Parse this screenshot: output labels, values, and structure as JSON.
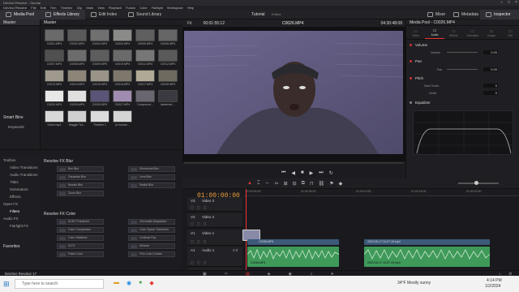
{
  "window": {
    "title": "DaVinci Resolve - Tutorial"
  },
  "menu": [
    "DaVinci Resolve",
    "File",
    "Edit",
    "Trim",
    "Timeline",
    "Clip",
    "Mark",
    "View",
    "Playback",
    "Fusion",
    "Color",
    "Fairlight",
    "Workspace",
    "Help"
  ],
  "toolbar": {
    "media_pool": "Media Pool",
    "effects_library": "Effects Library",
    "edit_index": "Edit Index",
    "sound_library": "Sound Library",
    "project_name": "Tutorial",
    "project_state": "Edited",
    "mixer": "Mixer",
    "metadata": "Metadata",
    "inspector": "Inspector"
  },
  "bins": {
    "master": "Master",
    "smart_bins": "Smart Bins",
    "keywords": "Keywords",
    "favorites": "Favorites"
  },
  "pool": {
    "header": "Master",
    "clips": [
      {
        "label": "C0001.MP4",
        "color": "#6a6a6a"
      },
      {
        "label": "C0002.MP4",
        "color": "#5a5a5a"
      },
      {
        "label": "C0003.MP4",
        "color": "#707070"
      },
      {
        "label": "C0004.MP4",
        "color": "#8a8a88"
      },
      {
        "label": "C0005.MP4",
        "color": "#5f5f5f"
      },
      {
        "label": "C0006.MP4",
        "color": "#666666"
      },
      {
        "label": "C0007.MP4",
        "color": "#505050"
      },
      {
        "label": "C0008.MP4",
        "color": "#6c6c6c"
      },
      {
        "label": "C0009.MP4",
        "color": "#5d5d5d"
      },
      {
        "label": "C0010.MP4",
        "color": "#6a6a6a"
      },
      {
        "label": "C0011.MP4",
        "color": "#777777"
      },
      {
        "label": "C0012.MP4",
        "color": "#5a5a5a"
      },
      {
        "label": "C0013.MP4",
        "color": "#a09a8e"
      },
      {
        "label": "C0014.MP4",
        "color": "#8c8578"
      },
      {
        "label": "C0015.MP4",
        "color": "#9a9488"
      },
      {
        "label": "C0016.MP4",
        "color": "#7d776c"
      },
      {
        "label": "C0017.MP4",
        "color": "#b0a996"
      },
      {
        "label": "C0018.MP4",
        "color": "#6f6a60"
      },
      {
        "label": "C0020.MP4",
        "color": "#e8e8e8"
      },
      {
        "label": "C0025.MP4",
        "color": "#e0e0e0"
      },
      {
        "label": "C0026.MP4",
        "color": "#5a5478"
      },
      {
        "label": "C0027.MP4",
        "color": "#a08cb0"
      },
      {
        "label": "Compound...",
        "color": "#6a6670"
      },
      {
        "label": "darkened ...",
        "color": "#3a3a40"
      },
      {
        "label": "Dutch.mp4",
        "color": "#d8d8d8"
      },
      {
        "label": "Maggie Tra...",
        "color": "#d0d0d0"
      },
      {
        "label": "Timeline 1",
        "color": "#dcdcdc"
      },
      {
        "label": "ja human...",
        "color": "#d4d4d4"
      }
    ]
  },
  "viewer": {
    "fit": "Fit",
    "source_tc": "00:01:55:12",
    "clip_name": "C0026.MP4",
    "duration_tc": "04:30:48:08"
  },
  "inspector": {
    "header": "Media Pool - C0026.MP4",
    "tabs": [
      "Video",
      "Audio",
      "Effects",
      "Transition",
      "Image",
      "File"
    ],
    "active_tab": "Audio",
    "volume": {
      "label": "Volume",
      "param": "Volume",
      "value": "0.00"
    },
    "pan": {
      "label": "Pan",
      "param": "Pan",
      "value": "0.00"
    },
    "pitch": {
      "label": "Pitch",
      "semitones_label": "Semi Tones",
      "semitones_value": "0",
      "cents_label": "Cents",
      "cents_value": "0"
    },
    "equalizer": {
      "label": "Equalizer"
    }
  },
  "effects": {
    "tree": [
      {
        "label": "Toolbox"
      },
      {
        "label": "Video Transitions"
      },
      {
        "label": "Audio Transitions"
      },
      {
        "label": "Titles"
      },
      {
        "label": "Generators"
      },
      {
        "label": "Effects"
      },
      {
        "label": "Open FX"
      },
      {
        "label": "Filters"
      },
      {
        "label": "Audio FX"
      },
      {
        "label": "Fairlight FX"
      }
    ],
    "blur_section": "Resolve FX Blur",
    "blur": [
      "Box Blur",
      "Directional Blur",
      "Gaussian Blur",
      "Lens Blur",
      "Mosaic Blur",
      "Radial Blur",
      "Zoom Blur"
    ],
    "color_section": "Resolve FX Color",
    "color": [
      "ACES Transform",
      "Chromatic Adaptation",
      "Color Compressor",
      "Color Space Transform",
      "Color Stabilizer",
      "Contrast Pop",
      "DCTL",
      "Dehaze",
      "False Color",
      "Film Look Creator"
    ]
  },
  "timeline": {
    "timecode": "01:00:00:00",
    "ruler": [
      "01:00:00:00",
      "01:00:05:00",
      "01:00:10:00",
      "01:00:15:00",
      "01:00:20:00"
    ],
    "tracks": [
      {
        "id": "V3",
        "name": "Video 3"
      },
      {
        "id": "V2",
        "name": "Video 2"
      },
      {
        "id": "V1",
        "name": "Video 1"
      },
      {
        "id": "A1",
        "name": "Audio 1",
        "level": "2.0"
      },
      {
        "id": "A2",
        "name": ""
      }
    ],
    "clips": {
      "v1a": "C0026.MP4",
      "v1b": "2023-06-17 16-07-15.mp4",
      "a1a": "C0026.MP4",
      "a1b": "2023-06-17 16-07-15.mp4"
    }
  },
  "bottomnav": {
    "app": "DaVinci Resolve 17"
  },
  "taskbar": {
    "search": "Type here to search",
    "weather": "34°F Mostly sunny",
    "time": "4:14 PM",
    "date": "1/2/2024"
  }
}
